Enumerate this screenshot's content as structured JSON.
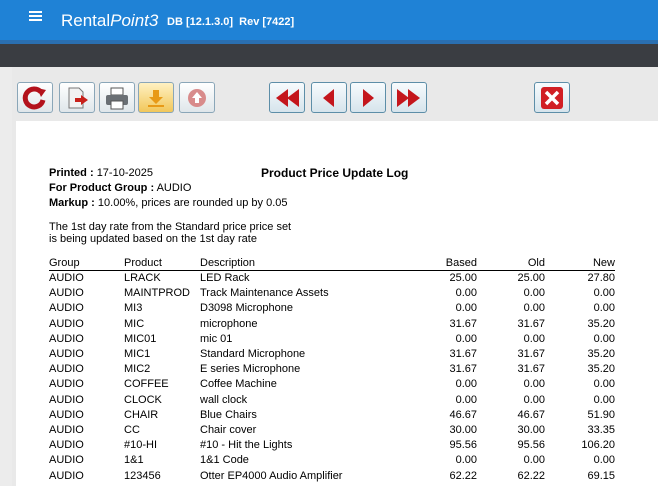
{
  "app": {
    "brand_plain": "Rental",
    "brand_italic": "Point3",
    "db": "DB [12.1.3.0]",
    "rev": "Rev [7422]"
  },
  "toolbar": {
    "icons": [
      "refresh-icon",
      "export-icon",
      "print-icon",
      "download-icon",
      "upload-icon",
      "first-page-icon",
      "previous-page-icon",
      "next-page-icon",
      "last-page-icon",
      "close-icon"
    ]
  },
  "report": {
    "printed_label": "Printed :",
    "printed_value": "17-10-2025",
    "title": "Product Price Update Log",
    "group_label": "For Product Group :",
    "group_value": "AUDIO",
    "markup_label": "Markup :",
    "markup_value": "10.00%, prices are rounded up by 0.05",
    "note_line1": "The 1st day rate from the Standard price price set",
    "note_line2": "is being updated based on the 1st day rate",
    "columns": [
      "Group",
      "Product",
      "Description",
      "Based",
      "Old",
      "New"
    ],
    "rows": [
      [
        "AUDIO",
        "LRACK",
        "LED Rack",
        "25.00",
        "25.00",
        "27.80"
      ],
      [
        "AUDIO",
        "MAINTPROD",
        "Track Maintenance Assets",
        "0.00",
        "0.00",
        "0.00"
      ],
      [
        "AUDIO",
        "MI3",
        "D3098 Microphone",
        "0.00",
        "0.00",
        "0.00"
      ],
      [
        "AUDIO",
        "MIC",
        "microphone",
        "31.67",
        "31.67",
        "35.20"
      ],
      [
        "AUDIO",
        "MIC01",
        "mic 01",
        "0.00",
        "0.00",
        "0.00"
      ],
      [
        "AUDIO",
        "MIC1",
        "Standard Microphone",
        "31.67",
        "31.67",
        "35.20"
      ],
      [
        "AUDIO",
        "MIC2",
        "E series Microphone",
        "31.67",
        "31.67",
        "35.20"
      ],
      [
        "AUDIO",
        "COFFEE",
        "Coffee Machine",
        "0.00",
        "0.00",
        "0.00"
      ],
      [
        "AUDIO",
        "CLOCK",
        "wall clock",
        "0.00",
        "0.00",
        "0.00"
      ],
      [
        "AUDIO",
        "CHAIR",
        "Blue Chairs",
        "46.67",
        "46.67",
        "51.90"
      ],
      [
        "AUDIO",
        "CC",
        "Chair cover",
        "30.00",
        "30.00",
        "33.35"
      ],
      [
        "AUDIO",
        "#10-HI",
        "#10 - Hit the Lights",
        "95.56",
        "95.56",
        "106.20"
      ],
      [
        "AUDIO",
        "1&1",
        "1&1 Code",
        "0.00",
        "0.00",
        "0.00"
      ],
      [
        "AUDIO",
        "123456",
        "Otter EP4000 Audio Amplifier",
        "62.22",
        "62.22",
        "69.15"
      ]
    ]
  }
}
